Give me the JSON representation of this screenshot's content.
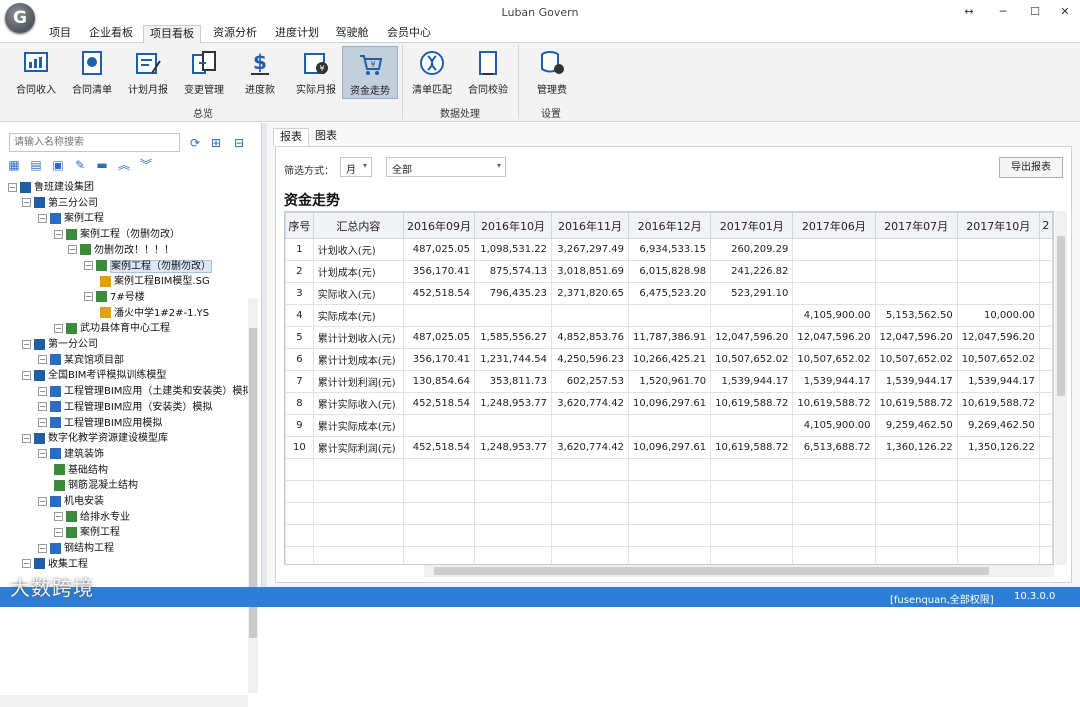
{
  "window": {
    "title": "Luban Govern",
    "logo_letter": "G",
    "controls": [
      "↔",
      "─",
      "☐",
      "✕"
    ]
  },
  "menu": [
    "项目",
    "企业看板",
    "项目看板",
    "资源分析",
    "进度计划",
    "驾驶舱",
    "会员中心"
  ],
  "ribbon": {
    "buttons": [
      "合同收入",
      "合同清单",
      "计划月报",
      "变更管理",
      "进度款",
      "实际月报",
      "资金走势",
      "清单匹配",
      "合同校验",
      "管理费"
    ],
    "groups": [
      "总览",
      "数据处理",
      "设置"
    ],
    "active": "资金走势"
  },
  "tree": {
    "search_placeholder": "请输入名称搜索",
    "items": [
      {
        "label": "鲁班建设集团",
        "level": 0
      },
      {
        "label": "第三分公司",
        "level": 1
      },
      {
        "label": "案例工程",
        "level": 2
      },
      {
        "label": "案例工程（勿删勿改）",
        "level": 3
      },
      {
        "label": "勿删勿改！！！！",
        "level": 4
      },
      {
        "label": "案例工程（勿删勿改）",
        "level": 5,
        "selected": true
      },
      {
        "label": "案例工程BIM模型.SG",
        "level": 6
      },
      {
        "label": "7#号楼",
        "level": 5
      },
      {
        "label": "潘火中学1#2#-1.YS",
        "level": 6
      },
      {
        "label": "武功县体育中心工程",
        "level": 3
      },
      {
        "label": "第一分公司",
        "level": 1
      },
      {
        "label": "某宾馆项目部",
        "level": 2
      },
      {
        "label": "全国BIM考评模拟训练模型",
        "level": 1
      },
      {
        "label": "工程管理BIM应用（土建类和安装类）模拟",
        "level": 2
      },
      {
        "label": "工程管理BIM应用（安装类）模拟",
        "level": 2
      },
      {
        "label": "工程管理BIM应用模拟",
        "level": 2
      },
      {
        "label": "数字化教学资源建设模型库",
        "level": 1
      },
      {
        "label": "建筑装饰",
        "level": 2
      },
      {
        "label": "基础结构",
        "level": 3
      },
      {
        "label": "钢筋混凝土结构",
        "level": 3
      },
      {
        "label": "机电安装",
        "level": 2
      },
      {
        "label": "给排水专业",
        "level": 3
      },
      {
        "label": "案例工程",
        "level": 3
      },
      {
        "label": "钢结构工程",
        "level": 2
      },
      {
        "label": "收集工程",
        "level": 1
      }
    ]
  },
  "tabs": [
    "报表",
    "图表"
  ],
  "filter": {
    "label": "筛选方式：",
    "mode": "月",
    "scope": "全部",
    "export_label": "导出报表"
  },
  "report": {
    "title": "资金走势",
    "headers": [
      "序号",
      "汇总内容",
      "2016年09月",
      "2016年10月",
      "2016年11月",
      "2016年12月",
      "2017年01月",
      "2017年06月",
      "2017年07月",
      "2017年10月",
      "2"
    ],
    "rows": [
      [
        "1",
        "计划收入(元)",
        "487,025.05",
        "1,098,531.22",
        "3,267,297.49",
        "6,934,533.15",
        "260,209.29",
        "",
        "",
        ""
      ],
      [
        "2",
        "计划成本(元)",
        "356,170.41",
        "875,574.13",
        "3,018,851.69",
        "6,015,828.98",
        "241,226.82",
        "",
        "",
        ""
      ],
      [
        "3",
        "实际收入(元)",
        "452,518.54",
        "796,435.23",
        "2,371,820.65",
        "6,475,523.20",
        "523,291.10",
        "",
        "",
        ""
      ],
      [
        "4",
        "实际成本(元)",
        "",
        "",
        "",
        "",
        "",
        "4,105,900.00",
        "5,153,562.50",
        "10,000.00"
      ],
      [
        "5",
        "累计计划收入(元)",
        "487,025.05",
        "1,585,556.27",
        "4,852,853.76",
        "11,787,386.91",
        "12,047,596.20",
        "12,047,596.20",
        "12,047,596.20",
        "12,047,596.20"
      ],
      [
        "6",
        "累计计划成本(元)",
        "356,170.41",
        "1,231,744.54",
        "4,250,596.23",
        "10,266,425.21",
        "10,507,652.02",
        "10,507,652.02",
        "10,507,652.02",
        "10,507,652.02"
      ],
      [
        "7",
        "累计计划利润(元)",
        "130,854.64",
        "353,811.73",
        "602,257.53",
        "1,520,961.70",
        "1,539,944.17",
        "1,539,944.17",
        "1,539,944.17",
        "1,539,944.17"
      ],
      [
        "8",
        "累计实际收入(元)",
        "452,518.54",
        "1,248,953.77",
        "3,620,774.42",
        "10,096,297.61",
        "10,619,588.72",
        "10,619,588.72",
        "10,619,588.72",
        "10,619,588.72"
      ],
      [
        "9",
        "累计实际成本(元)",
        "",
        "",
        "",
        "",
        "",
        "4,105,900.00",
        "9,259,462.50",
        "9,269,462.50"
      ],
      [
        "10",
        "累计实际利润(元)",
        "452,518.54",
        "1,248,953.77",
        "3,620,774.42",
        "10,096,297.61",
        "10,619,588.72",
        "6,513,688.72",
        "1,360,126.22",
        "1,350,126.22"
      ]
    ]
  },
  "status": {
    "user": "[fusenquan,全部权限]",
    "version": "10.3.0.0"
  },
  "watermark": "大数跨境",
  "colors": {
    "accent": "#2c7fd6",
    "ribbon_bg": "#f3f3f3",
    "active_btn": "#c3cedb"
  }
}
